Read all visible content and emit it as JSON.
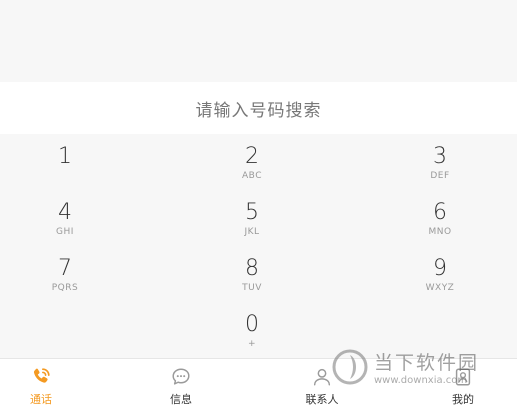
{
  "search": {
    "placeholder": "请输入号码搜索"
  },
  "keypad": {
    "keys": [
      {
        "digit": "1",
        "letters": ""
      },
      {
        "digit": "2",
        "letters": "ABC"
      },
      {
        "digit": "3",
        "letters": "DEF"
      },
      {
        "digit": "4",
        "letters": "GHI"
      },
      {
        "digit": "5",
        "letters": "JKL"
      },
      {
        "digit": "6",
        "letters": "MNO"
      },
      {
        "digit": "7",
        "letters": "PQRS"
      },
      {
        "digit": "8",
        "letters": "TUV"
      },
      {
        "digit": "9",
        "letters": "WXYZ"
      },
      {
        "digit": "0",
        "letters": "+"
      }
    ]
  },
  "nav": {
    "items": [
      {
        "label": "通话",
        "icon": "phone-icon",
        "active": true
      },
      {
        "label": "信息",
        "icon": "message-icon",
        "active": false
      },
      {
        "label": "联系人",
        "icon": "contacts-icon",
        "active": false
      },
      {
        "label": "我的",
        "icon": "profile-icon",
        "active": false
      }
    ]
  },
  "watermark": {
    "name": "当下软件园",
    "url": "www.downxia.com"
  },
  "colors": {
    "accent": "#f49a22",
    "text": "#333333",
    "muted": "#999999",
    "background": "#f7f7f7"
  }
}
